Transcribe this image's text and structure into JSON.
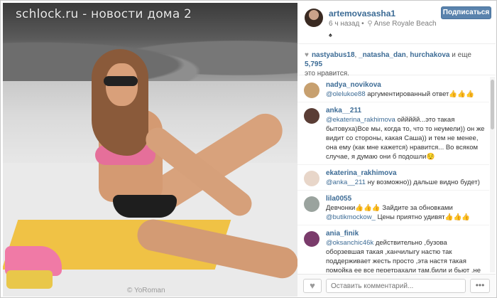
{
  "watermark": "schlock.ru - новости дома 2",
  "photo_credit": "© YoRoman",
  "post": {
    "username": "artemovasasha1",
    "time": "6 ч назад",
    "location_separator": "•",
    "location": "Anse Royale Beach",
    "dot": "♠",
    "follow_label": "Подписаться"
  },
  "likes": {
    "users": [
      "nastyabus18",
      "_natasha_dan",
      "hurchakova"
    ],
    "sep1": ", ",
    "sep2": ", ",
    "more_text": " и еще ",
    "count": "5,795",
    "suffix": "это нравится."
  },
  "comments": [
    {
      "user": "nadya_novikova",
      "mention": "@olelukoe88",
      "text": " аргументированный ответ👍👍👍",
      "avatar_color": "#c7a06f"
    },
    {
      "user": "anka__211",
      "mention": "@ekaterina_rakhimova",
      "text": " оййййй...это такая бытовуха)Все мы, когда то, что то неумели)) он же видит со стороны, какая Саша)) и тем не менее, она ему (как мне кажется) нравится... Во всяком случае, я думаю они б подошли😌",
      "avatar_color": "#5a3d35"
    },
    {
      "user": "ekaterina_rakhimova",
      "mention": "@anka__211",
      "text": " ну возможно)) дальше видно будет)",
      "avatar_color": "#e8d6c9"
    },
    {
      "user": "lila0055",
      "mention": "",
      "text": "Девчонки👍👍👍 Зайдите за обновками",
      "mention2": "@butikmockow_",
      "text2": " Цены приятно удивят👍👍👍",
      "avatar_color": "#9aa39e"
    },
    {
      "user": "ania_finik",
      "mention": "@oksanchic46k",
      "text": " действительно ,бузова оборзевшая такая ,канчилыгу настю так поддерживает жесть просто ,эта настя такая помойка ее все перетрахали там,били и бьют ,не во что не ставят,а она все гонит шалава дешевая фу👎👎👎",
      "avatar_color": "#7a3b6b"
    }
  ],
  "footer": {
    "comment_placeholder": "Оставить комментарий...",
    "more_label": "•••",
    "heart": "♥"
  },
  "icons": {
    "heart": "heart-icon",
    "location": "location-pin-icon"
  }
}
